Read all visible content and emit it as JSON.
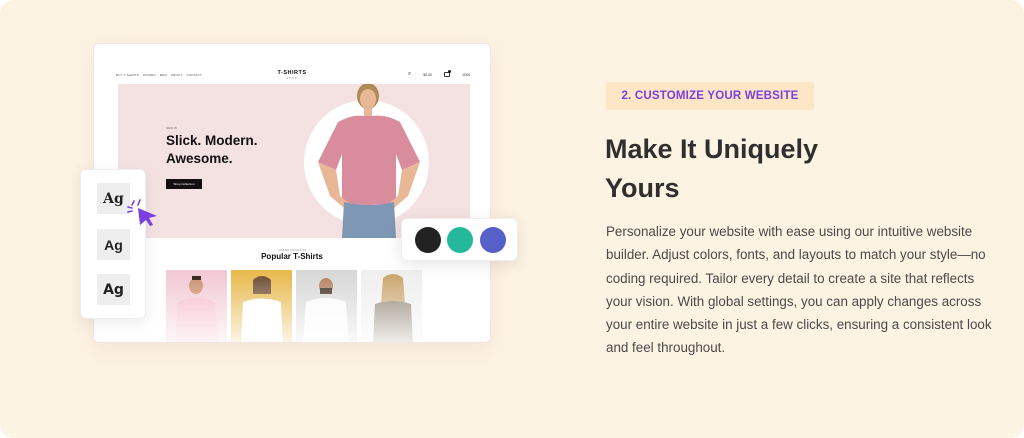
{
  "mockup": {
    "nav_links": [
      "BUY T-SHIRTS",
      "WOMEN",
      "MEN",
      "ABOUT",
      "CONTACT"
    ],
    "brand": "T-SHIRTS",
    "brand_tagline": "SHOP",
    "cart_total": "$0.00",
    "account_label": "JOIN",
    "hero": {
      "eyebrow": "NEW IN",
      "title": "Slick. Modern. Awesome.",
      "button_label": "Shop Collection"
    },
    "section": {
      "eyebrow": "SUMMER COLLECTION",
      "title": "Popular T-Shirts"
    },
    "products": [
      {
        "name": "pink-tshirt",
        "bg": "#f2c9d4",
        "shirt": "#f5b8c9",
        "skin": "#c98e6a"
      },
      {
        "name": "white-tshirt-1",
        "bg": "#e8b94e",
        "shirt": "#ffffff",
        "skin": "#e2b28f"
      },
      {
        "name": "white-tshirt-2",
        "bg": "#d7d7d7",
        "shirt": "#fafafa",
        "skin": "#b27f5c"
      },
      {
        "name": "graphic-tshirt",
        "bg": "#efefef",
        "shirt": "#8a7f6d",
        "skin": "#e6c19a"
      }
    ]
  },
  "font_panel": {
    "samples": [
      "Ag",
      "Ag",
      "Ag"
    ]
  },
  "color_panel": {
    "colors": [
      "#222222",
      "#26b89a",
      "#5660c9"
    ]
  },
  "content": {
    "step_label": "2. CUSTOMIZE YOUR WEBSITE",
    "heading_line1": "Make It Uniquely",
    "heading_line2": "Yours",
    "paragraph": "Personalize your website with ease using our intuitive website builder. Adjust colors, fonts, and layouts to match your style—no coding required. Tailor every detail to create a site that reflects your vision. With global settings, you can apply changes across your entire website in just a few clicks, ensuring a consistent look and feel throughout."
  },
  "colors": {
    "background": "#fdf3e3",
    "accent": "#7a3fdd",
    "badge_bg": "#fde6c6",
    "hero_bg": "#f4e2e3"
  }
}
